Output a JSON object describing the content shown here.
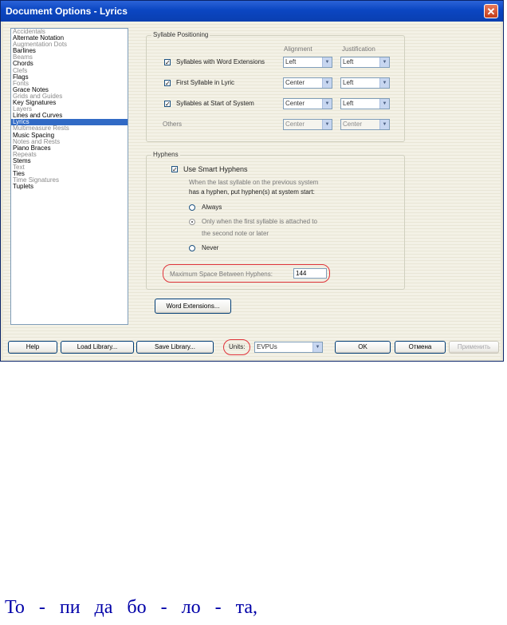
{
  "window": {
    "title": "Document Options - Lyrics",
    "close_glyph": "✕"
  },
  "categories": [
    {
      "label": "Accidentals",
      "state": "dim"
    },
    {
      "label": "Alternate Notation",
      "state": "normal"
    },
    {
      "label": "Augmentation Dots",
      "state": "dim"
    },
    {
      "label": "Barlines",
      "state": "normal"
    },
    {
      "label": "Beams",
      "state": "dim"
    },
    {
      "label": "Chords",
      "state": "normal"
    },
    {
      "label": "Clefs",
      "state": "dim"
    },
    {
      "label": "Flags",
      "state": "normal"
    },
    {
      "label": "Fonts",
      "state": "dim"
    },
    {
      "label": "Grace Notes",
      "state": "normal"
    },
    {
      "label": "Grids and Guides",
      "state": "dim"
    },
    {
      "label": "Key Signatures",
      "state": "normal"
    },
    {
      "label": "Layers",
      "state": "dim"
    },
    {
      "label": "Lines and Curves",
      "state": "normal"
    },
    {
      "label": "Lyrics",
      "state": "selected"
    },
    {
      "label": "Multimeasure Rests",
      "state": "dim"
    },
    {
      "label": "Music Spacing",
      "state": "normal"
    },
    {
      "label": "Notes and Rests",
      "state": "dim"
    },
    {
      "label": "Piano Braces",
      "state": "normal"
    },
    {
      "label": "Repeats",
      "state": "dim"
    },
    {
      "label": "Stems",
      "state": "normal"
    },
    {
      "label": "Text",
      "state": "dim"
    },
    {
      "label": "Ties",
      "state": "normal"
    },
    {
      "label": "Time Signatures",
      "state": "dim"
    },
    {
      "label": "Tuplets",
      "state": "normal"
    }
  ],
  "syllable_positioning": {
    "group_label": "Syllable Positioning",
    "col_alignment": "Alignment",
    "col_justification": "Justification",
    "rows": [
      {
        "label": "Syllables with Word Extensions",
        "checked": "✓",
        "alignment": "Left",
        "justification": "Left"
      },
      {
        "label": "First Syllable in Lyric",
        "checked": "✓",
        "alignment": "Center",
        "justification": "Left"
      },
      {
        "label": "Syllables at Start of System",
        "checked": "✓",
        "alignment": "Center",
        "justification": "Left"
      },
      {
        "label": "Others",
        "checked": "",
        "alignment": "Center",
        "justification": "Center"
      }
    ]
  },
  "hyphens": {
    "group_label": "Hyphens",
    "use_smart_label": "Use Smart Hyphens",
    "use_smart_check": "✓",
    "desc_line1": "When the last syllable on the previous system",
    "desc_line2": "has a hyphen, put hyphen(s) at system start:",
    "opt_always": "Always",
    "opt_only_line1": "Only when the first syllable is attached to",
    "opt_only_line2": "the second note or later",
    "opt_never": "Never",
    "max_space_label": "Maximum Space Between Hyphens:",
    "max_space_value": "144"
  },
  "word_extensions_button": "Word Extensions...",
  "bottom": {
    "help": "Help",
    "load_library": "Load Library...",
    "save_library": "Save Library...",
    "units_label": "Units:",
    "units_value": "EVPUs",
    "ok": "OK",
    "cancel": "Отмена",
    "apply": "Применить"
  },
  "lyric_line": [
    "То",
    "-",
    "пи",
    "да",
    "бо",
    "-",
    "ло",
    "-",
    "та,"
  ],
  "colors": {
    "lyric": "#0000a8",
    "annotation": "#e0333a",
    "selection": "#316ac5"
  }
}
